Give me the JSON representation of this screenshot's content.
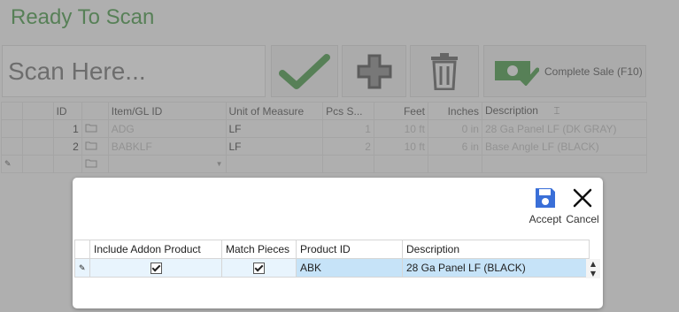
{
  "title": "Ready To Scan",
  "scan": {
    "placeholder": "Scan Here..."
  },
  "toolbar": {
    "confirm_icon": "checkmark-icon",
    "add_icon": "plus-icon",
    "delete_icon": "trash-icon",
    "complete_sale_label": "Complete Sale (F10)",
    "accent": "#4c9a4c"
  },
  "grid": {
    "columns": [
      "ID",
      "Item/GL ID",
      "Unit of Measure",
      "Pcs S...",
      "Feet",
      "Inches",
      "Description"
    ],
    "rows": [
      {
        "id": "1",
        "item": "ADG",
        "uom": "LF",
        "pcs": "1",
        "feet": "10 ft",
        "inches": "0 in",
        "desc": "28 Ga Panel LF (DK GRAY)"
      },
      {
        "id": "2",
        "item": "BABKLF",
        "uom": "LF",
        "pcs": "2",
        "feet": "10 ft",
        "inches": "6 in",
        "desc": "Base Angle LF (BLACK)"
      }
    ]
  },
  "dialog": {
    "accept_label": "Accept",
    "cancel_label": "Cancel",
    "columns": [
      "Include Addon Product",
      "Match Pieces",
      "Product ID",
      "Description"
    ],
    "rows": [
      {
        "include": true,
        "match": true,
        "product_id": "ABK",
        "description": "28 Ga Panel LF (BLACK)"
      }
    ],
    "accept_color": "#3a6fd8"
  }
}
